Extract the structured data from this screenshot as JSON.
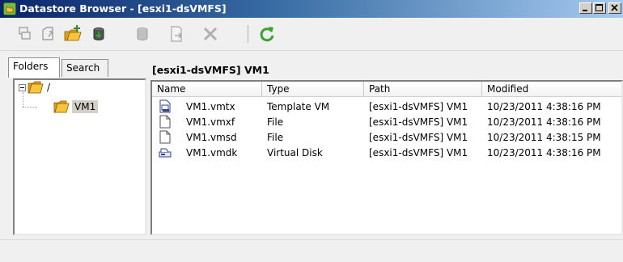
{
  "window": {
    "title": "Datastore Browser - [esxi1-dsVMFS]"
  },
  "toolbar": {
    "buttons": [
      {
        "icon": "datastore-browse-icon",
        "enabled": false
      },
      {
        "icon": "upload-icon",
        "enabled": false
      },
      {
        "icon": "new-folder-icon",
        "enabled": true
      },
      {
        "icon": "upload-file-icon",
        "enabled": true
      },
      {
        "icon": "download-icon",
        "enabled": false
      },
      {
        "icon": "register-vm-icon",
        "enabled": false
      },
      {
        "icon": "delete-icon",
        "enabled": false
      },
      {
        "icon": "refresh-icon",
        "enabled": true
      }
    ]
  },
  "tabs": {
    "folders": "Folders",
    "search": "Search",
    "active": "folders"
  },
  "tree": {
    "root": "/",
    "child": "VM1"
  },
  "list": {
    "path_label": "[esxi1-dsVMFS] VM1",
    "columns": [
      "Name",
      "Type",
      "Path",
      "Modified"
    ],
    "rows": [
      {
        "icon": "template-vm-icon",
        "name": "VM1.vmtx",
        "type": "Template VM",
        "path": "[esxi1-dsVMFS] VM1",
        "modified": "10/23/2011 4:38:16 PM"
      },
      {
        "icon": "file-icon",
        "name": "VM1.vmxf",
        "type": "File",
        "path": "[esxi1-dsVMFS] VM1",
        "modified": "10/23/2011 4:38:16 PM"
      },
      {
        "icon": "file-icon",
        "name": "VM1.vmsd",
        "type": "File",
        "path": "[esxi1-dsVMFS] VM1",
        "modified": "10/23/2011 4:38:15 PM"
      },
      {
        "icon": "virtual-disk-icon",
        "name": "VM1.vmdk",
        "type": "Virtual Disk",
        "path": "[esxi1-dsVMFS] VM1",
        "modified": "10/23/2011 4:38:16 PM"
      }
    ]
  },
  "colors": {
    "titlebar_start": "#0a246a",
    "titlebar_end": "#a6caf0",
    "folder_yellow": "#f5c542",
    "refresh_green": "#3aa02e"
  }
}
